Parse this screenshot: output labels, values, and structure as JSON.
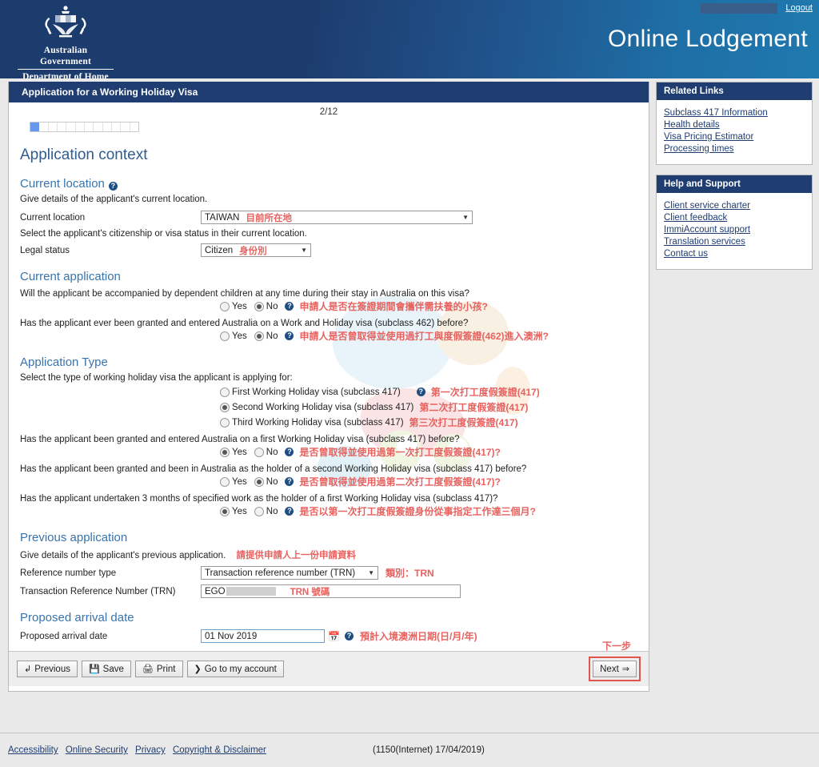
{
  "banner": {
    "crest_line1": "Australian Government",
    "crest_line2": "Department of Home Affairs",
    "title": "Online Lodgement",
    "logout_label": "Logout"
  },
  "main": {
    "header": "Application for a Working Holiday Visa",
    "pager": "2/12",
    "progress": {
      "total": 12,
      "filled": 1
    },
    "page_title": "Application context",
    "sections": {
      "current_location": {
        "heading": "Current location",
        "hint": "Give details of the applicant's current location.",
        "location_label": "Current location",
        "location_value": "TAIWAN",
        "location_note_cn": "目前所在地",
        "citizenship_hint": "Select the applicant's citizenship or visa status in their current location.",
        "legal_status_label": "Legal status",
        "legal_status_value": "Citizen",
        "legal_status_note_cn": "身份別"
      },
      "current_application": {
        "heading": "Current application",
        "q1": "Will the applicant be accompanied by dependent children at any time during their stay in Australia on this visa?",
        "q1_answer": "No",
        "q1_note_cn": "申請人是否在簽證期間會攜伴需扶養的小孩?",
        "q2": "Has the applicant ever been granted and entered Australia on a Work and Holiday visa (subclass 462) before?",
        "q2_answer": "No",
        "q2_note_cn": "申請人是否曾取得並使用過打工與度假簽證(462)進入澳洲?"
      },
      "application_type": {
        "heading": "Application Type",
        "hint": "Select the type of working holiday visa the applicant is applying for:",
        "choices": [
          {
            "label": "First Working Holiday visa (subclass 417)",
            "selected": false,
            "help": true,
            "note_cn": "第一次打工度假簽證(417)"
          },
          {
            "label": "Second Working Holiday visa (subclass 417)",
            "selected": true,
            "help": false,
            "note_cn": "第二次打工度假簽證(417)"
          },
          {
            "label": "Third Working Holiday visa (subclass 417)",
            "selected": false,
            "help": false,
            "note_cn": "第三次打工度假簽證(417)"
          }
        ],
        "q1": "Has the applicant been granted and entered Australia on a first Working Holiday visa (subclass 417) before?",
        "q1_answer": "Yes",
        "q1_note_cn": "是否曾取得並使用過第一次打工度假簽證(417)?",
        "q2": "Has the applicant been granted and been in Australia as the holder of a second Working Holiday visa (subclass 417) before?",
        "q2_answer": "No",
        "q2_note_cn": "是否曾取得並使用過第二次打工度假簽證(417)?",
        "q3": "Has the applicant undertaken 3 months of specified work as the holder of a first Working Holiday visa (subclass 417)?",
        "q3_answer": "Yes",
        "q3_note_cn": "是否以第一次打工度假簽證身份從事指定工作達三個月?"
      },
      "previous_application": {
        "heading": "Previous application",
        "hint": "Give details of the applicant's previous application.",
        "hint_note_cn": "請提供申請人上一份申請資料",
        "ref_type_label": "Reference number type",
        "ref_type_value": "Transaction reference number (TRN)",
        "ref_type_note_cn": "類別：TRN",
        "trn_label": "Transaction Reference Number (TRN)",
        "trn_value": "EGO",
        "trn_note_cn": "TRN 號碼"
      },
      "proposed_arrival": {
        "heading": "Proposed arrival date",
        "label": "Proposed arrival date",
        "value": "01 Nov 2019",
        "note_cn": "預計入境澳洲日期(日/月/年)"
      }
    },
    "radio_yes": "Yes",
    "radio_no": "No",
    "buttons": {
      "previous": "Previous",
      "save": "Save",
      "print": "Print",
      "account": "Go to my account",
      "next": "Next",
      "next_note_cn": "下一步"
    }
  },
  "sidebar": {
    "cards": [
      {
        "title": "Related Links",
        "links": [
          "Subclass 417 Information",
          "Health details",
          "Visa Pricing Estimator",
          "Processing times"
        ]
      },
      {
        "title": "Help and Support",
        "links": [
          "Client service charter",
          "Client feedback",
          "ImmiAccount support",
          "Translation services",
          "Contact us"
        ]
      }
    ]
  },
  "footer": {
    "links": [
      "Accessibility",
      "Online Security",
      "Privacy",
      "Copyright & Disclaimer"
    ],
    "build": "(1150(Internet) 17/04/2019)"
  },
  "colors": {
    "navy": "#1f3d70",
    "heading_blue": "#3774ad",
    "annotation_red": "#e8625f",
    "progress_blue": "#6699ee"
  }
}
